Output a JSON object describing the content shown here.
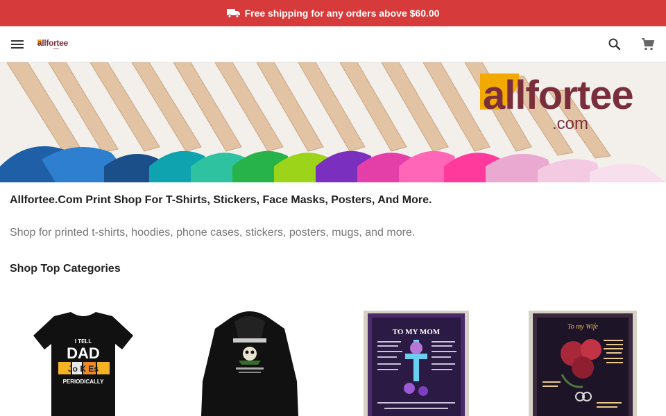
{
  "promo": {
    "icon": "truck-icon",
    "text": "Free shipping for any orders above $60.00"
  },
  "header": {
    "logo_text": "allfortee",
    "logo_sub": ".com",
    "menu_icon": "hamburger-menu-icon",
    "search_icon": "search-icon",
    "cart_icon": "shopping-cart-icon"
  },
  "hero": {
    "logo_word": "allfortee",
    "logo_sub": ".com"
  },
  "main": {
    "heading": "Allfortee.Com Print Shop For T-Shirts, Stickers, Face Masks, Posters, And More.",
    "subheading": "Shop for printed t-shirts, hoodies, phone cases, stickers, posters, mugs, and more.",
    "section_title": "Shop Top Categories"
  },
  "categories": [
    {
      "name": "t-shirt",
      "print_lines": [
        "I TELL",
        "DAD",
        "Jo K Es",
        "PERIODICALLY"
      ]
    },
    {
      "name": "hoodie"
    },
    {
      "name": "mom-blanket",
      "print_lines": [
        "TO MY MOM"
      ]
    },
    {
      "name": "wife-blanket",
      "print_lines": [
        "To my Wife"
      ]
    }
  ],
  "colors": {
    "promo_bg": "#d63a3a",
    "brand_maroon": "#7a2e3b",
    "brand_yellow": "#f2a900"
  }
}
